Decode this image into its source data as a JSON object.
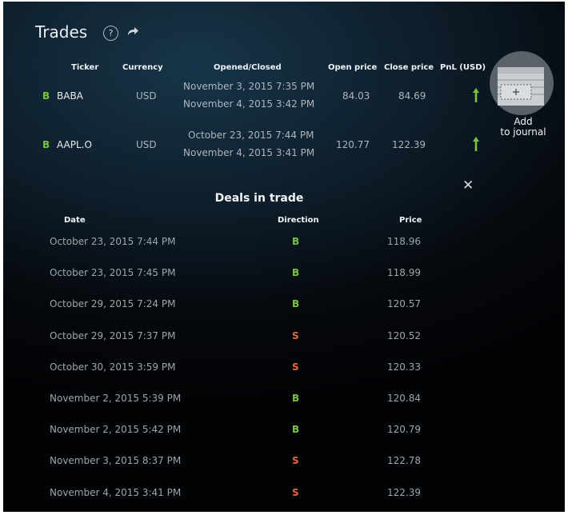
{
  "header": {
    "title": "Trades",
    "help_glyph": "?",
    "icons": [
      "help-icon",
      "share-icon"
    ]
  },
  "trades_table": {
    "columns": [
      "Ticker",
      "Currency",
      "Opened/Closed",
      "Open price",
      "Close price",
      "PnL (USD)"
    ],
    "rows": [
      {
        "side": "B",
        "ticker": "BABA",
        "currency": "USD",
        "opened": "November 3, 2015 7:35 PM",
        "closed": "November 4, 2015 3:42 PM",
        "open_price": "84.03",
        "close_price": "84.69",
        "pnl_icon": "arrow-up-icon"
      },
      {
        "side": "B",
        "ticker": "AAPL.O",
        "currency": "USD",
        "opened": "October 23, 2015 7:44 PM",
        "closed": "November 4, 2015 3:41 PM",
        "open_price": "120.77",
        "close_price": "122.39",
        "pnl_icon": "arrow-up-icon"
      }
    ]
  },
  "journal": {
    "label_line1": "Add",
    "label_line2": "to journal",
    "icon": "journal-add-icon"
  },
  "deals": {
    "title": "Deals in trade",
    "close_glyph": "✕",
    "columns": [
      "Date",
      "Direction",
      "Price"
    ],
    "rows": [
      {
        "date": "October 23, 2015 7:44 PM",
        "direction": "B",
        "price": "118.96"
      },
      {
        "date": "October 23, 2015 7:45 PM",
        "direction": "B",
        "price": "118.99"
      },
      {
        "date": "October 29, 2015 7:24 PM",
        "direction": "B",
        "price": "120.57"
      },
      {
        "date": "October 29, 2015 7:37 PM",
        "direction": "S",
        "price": "120.52"
      },
      {
        "date": "October 30, 2015 3:59 PM",
        "direction": "S",
        "price": "120.33"
      },
      {
        "date": "November 2, 2015 5:39 PM",
        "direction": "B",
        "price": "120.84"
      },
      {
        "date": "November 2, 2015 5:42 PM",
        "direction": "B",
        "price": "120.79"
      },
      {
        "date": "November 3, 2015 8:37 PM",
        "direction": "S",
        "price": "122.78"
      },
      {
        "date": "November 4, 2015 3:41 PM",
        "direction": "S",
        "price": "122.39"
      }
    ]
  },
  "colors": {
    "buy": "#7cc241",
    "sell": "#e46a3d",
    "background": "#071019"
  }
}
